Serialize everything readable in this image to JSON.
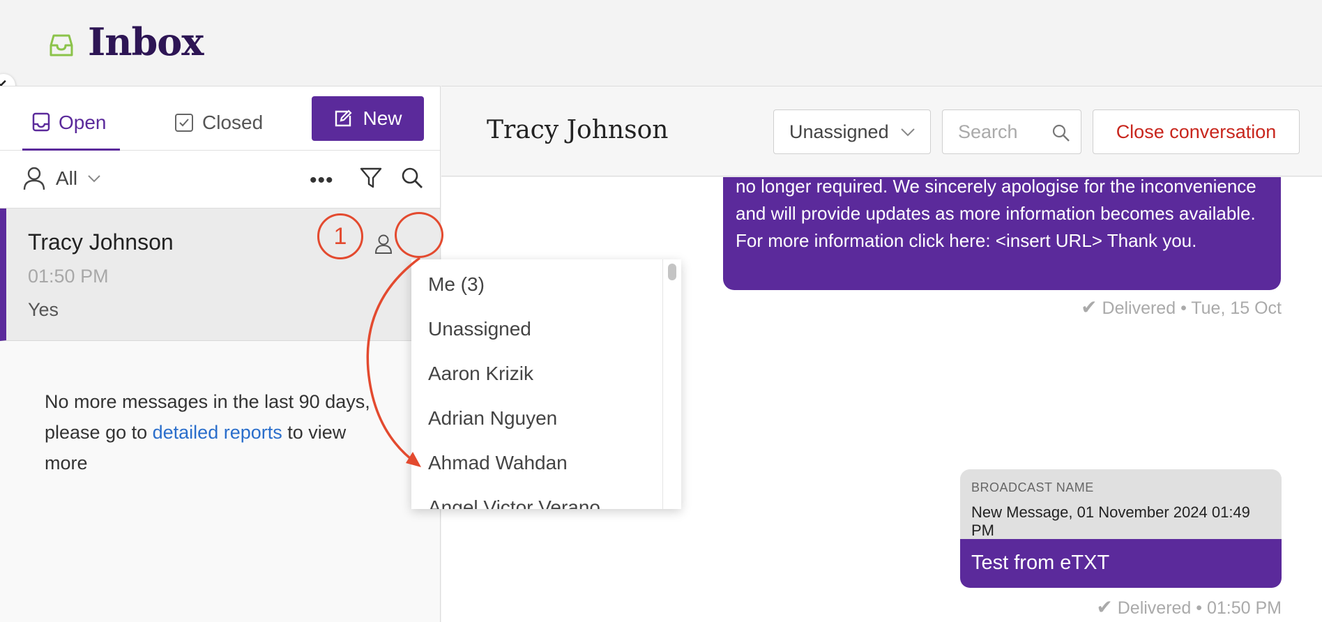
{
  "header": {
    "title": "Inbox"
  },
  "tabs": {
    "open_label": "Open",
    "closed_label": "Closed",
    "new_label": "New"
  },
  "filter": {
    "all_label": "All"
  },
  "conversation": {
    "name": "Tracy Johnson",
    "time": "01:50 PM",
    "preview": "Yes"
  },
  "no_more": {
    "text_before": "No more messages in the last 90 days, please go to ",
    "link": "detailed reports",
    "text_after": " to view more"
  },
  "chat_header": {
    "title": "Tracy Johnson",
    "assign_value": "Unassigned",
    "search_placeholder": "Search",
    "close_label": "Close conversation"
  },
  "messages": {
    "m1_text": "no longer required. We sincerely apologise for the inconvenience and will provide updates as more information becomes available. For more information click here: <insert URL> Thank you.",
    "m1_status": "Delivered • Tue, 15 Oct",
    "broadcast_label": "BROADCAST NAME",
    "broadcast_name": "New Message, 01 November 2024 01:49 PM",
    "m2_text": "Test from eTXT",
    "m2_status": "Delivered • 01:50 PM"
  },
  "dropdown": {
    "items": [
      "Me (3)",
      "Unassigned",
      "Aaron Krizik",
      "Adrian Nguyen",
      "Ahmad Wahdan",
      "Angel Victor Verano"
    ]
  },
  "annotation": {
    "step": "1"
  },
  "colors": {
    "brand_purple": "#5b2a9b",
    "title_purple": "#2d1554",
    "danger_red": "#c8261d",
    "annotation_red": "#e34a2f",
    "link_blue": "#2a6ecb",
    "icon_green": "#8bc34a"
  }
}
